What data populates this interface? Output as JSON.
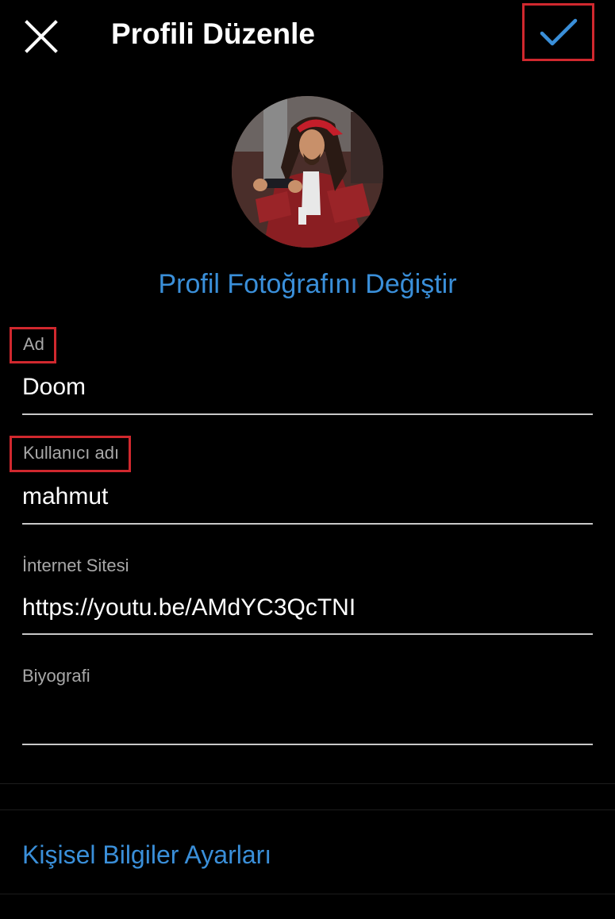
{
  "header": {
    "title": "Profili Düzenle",
    "close_icon": "close-icon",
    "confirm_icon": "checkmark-icon",
    "confirm_color": "#3a8fd9"
  },
  "profile": {
    "change_photo_label": "Profil Fotoğrafını Değiştir"
  },
  "fields": {
    "name": {
      "label": "Ad",
      "value": "Doom"
    },
    "username": {
      "label": "Kullanıcı adı",
      "value": "mahmut"
    },
    "website": {
      "label": "İnternet Sitesi",
      "value": "https://youtu.be/AMdYC3QcTNI"
    },
    "bio": {
      "label": "Biyografi",
      "value": ""
    }
  },
  "links": {
    "personal_info_settings": "Kişisel Bilgiler Ayarları"
  },
  "colors": {
    "background": "#000000",
    "accent": "#3a8fd9",
    "highlight_box": "#d0282e"
  }
}
